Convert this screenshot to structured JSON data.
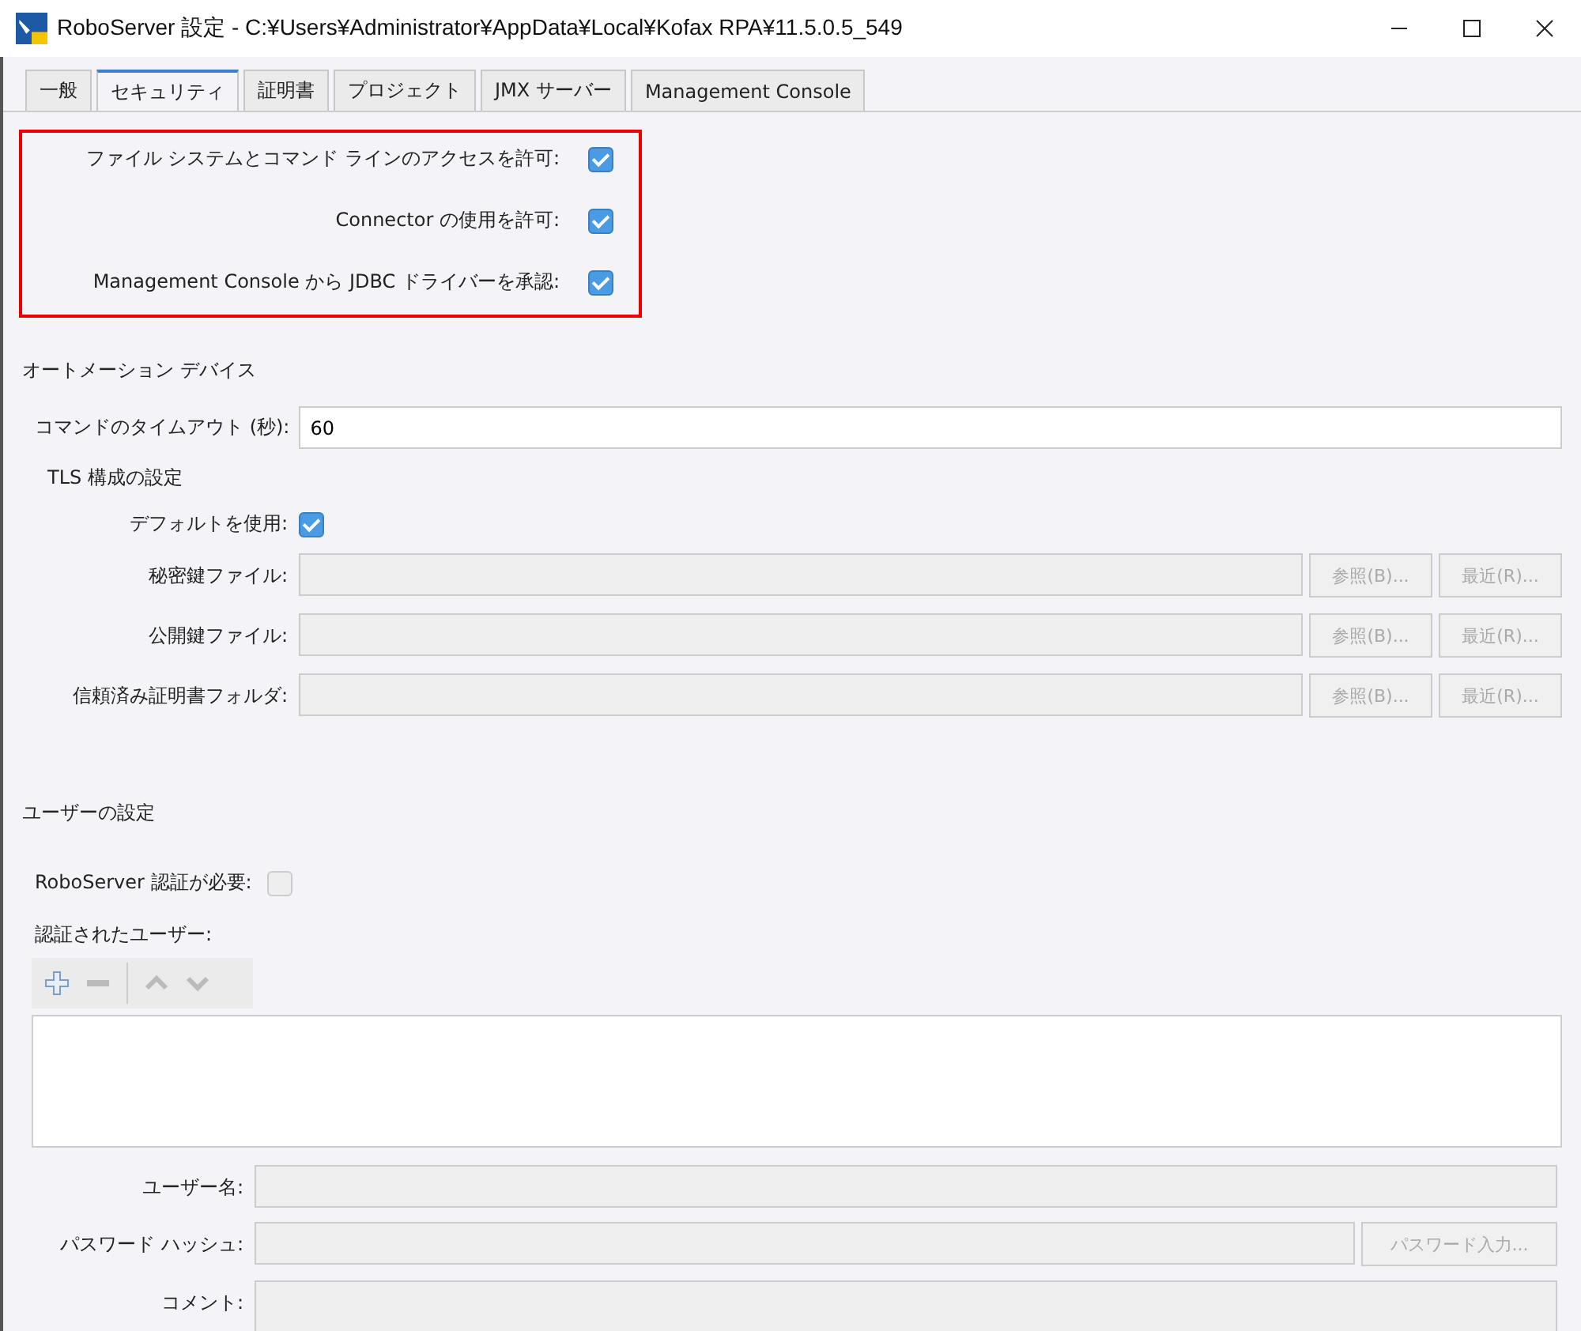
{
  "window": {
    "title": "RoboServer 設定 - C:¥Users¥Administrator¥AppData¥Local¥Kofax RPA¥11.5.0.5_549"
  },
  "tabs": [
    {
      "label": "一般",
      "selected": false
    },
    {
      "label": "セキュリティ",
      "selected": true
    },
    {
      "label": "証明書",
      "selected": false
    },
    {
      "label": "プロジェクト",
      "selected": false
    },
    {
      "label": "JMX サーバー",
      "selected": false
    },
    {
      "label": "Management Console",
      "selected": false
    }
  ],
  "access": [
    {
      "label": "ファイル システムとコマンド ラインのアクセスを許可:",
      "checked": true
    },
    {
      "label": "Connector の使用を許可:",
      "checked": true
    },
    {
      "label": "Management Console から JDBC ドライバーを承認:",
      "checked": true
    }
  ],
  "automation": {
    "heading": "オートメーション デバイス",
    "timeout_label": "コマンドのタイムアウト (秒):",
    "timeout_value": "60",
    "tls_heading": "TLS 構成の設定",
    "default_label": "デフォルトを使用:",
    "default_checked": true,
    "files": [
      {
        "label": "秘密鍵ファイル:",
        "browse": "参照(B)...",
        "recent": "最近(R)...",
        "disabled": true
      },
      {
        "label": "公開鍵ファイル:",
        "browse": "参照(B)...",
        "recent": "最近(R)...",
        "disabled": true
      },
      {
        "label": "信頼済み証明書フォルダ:",
        "browse": "参照(B)...",
        "recent": "最近(R)...",
        "disabled": true
      }
    ]
  },
  "users": {
    "heading": "ユーザーの設定",
    "auth_label": "RoboServer 認証が必要:",
    "auth_checked": false,
    "auth_disabled": true,
    "list_label": "認証されたユーザー:",
    "fields": [
      {
        "label": "ユーザー名:",
        "disabled": true
      },
      {
        "label": "パスワード ハッシュ:",
        "button": "パスワード入力...",
        "disabled": true
      },
      {
        "label": "コメント:",
        "kind": "area",
        "disabled": true
      }
    ]
  }
}
